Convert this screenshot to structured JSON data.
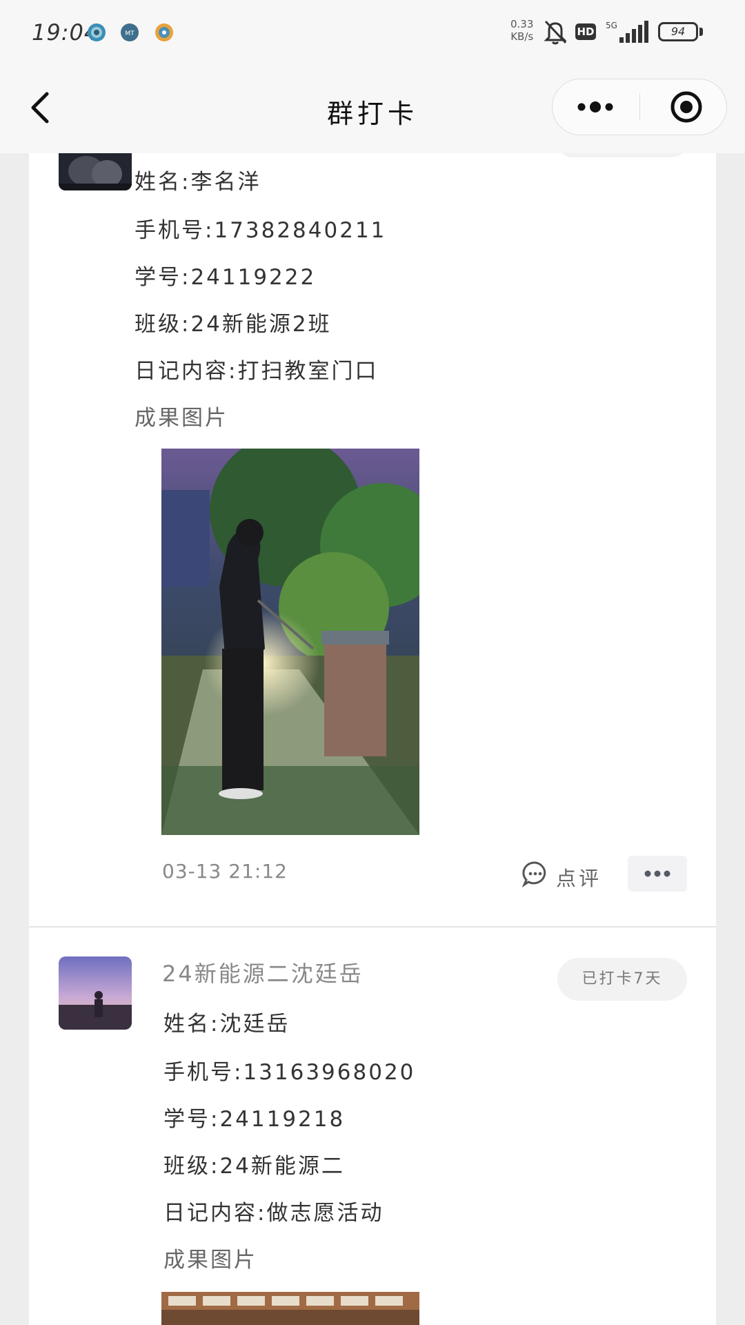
{
  "status_bar": {
    "time": "19:04",
    "speed_value": "0.33",
    "speed_unit": "KB/s",
    "hd": "HD",
    "network": "5G",
    "battery": "94"
  },
  "nav": {
    "title": "群打卡"
  },
  "posts": [
    {
      "name": "姓名:李名洋",
      "phone": "手机号:17382840211",
      "student_id": "学号:24119222",
      "class": "班级:24新能源2班",
      "diary": "日记内容:打扫教室门口",
      "photos_label": "成果图片",
      "time": "03-13 21:12",
      "comment_label": "点评"
    },
    {
      "nickname": "24新能源二沈廷岳",
      "badge": "已打卡7天",
      "name": "姓名:沈廷岳",
      "phone": "手机号:13163968020",
      "student_id": "学号:24119218",
      "class": "班级:24新能源二",
      "diary": "日记内容:做志愿活动",
      "photos_label": "成果图片"
    }
  ],
  "colors": {
    "background": "#ededed",
    "card": "#ffffff",
    "text": "#333333",
    "muted": "#888888"
  }
}
